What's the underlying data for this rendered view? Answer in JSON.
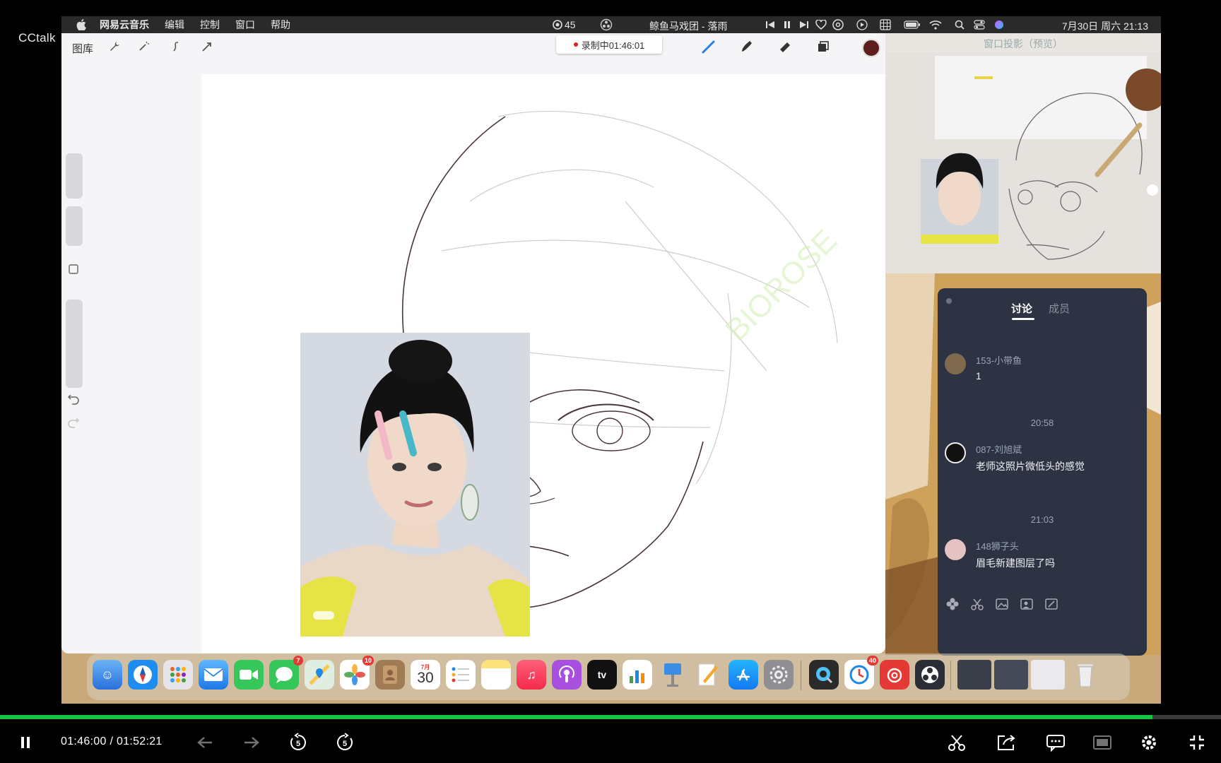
{
  "cctalk": {
    "logo": "CCtalk"
  },
  "menubar": {
    "app_name": "网易云音乐",
    "menus": [
      "编辑",
      "控制",
      "窗口",
      "帮助"
    ],
    "badge_count": "45",
    "song_title": "鲸鱼马戏团 - 落雨",
    "datetime": "7月30日 周六 21:13"
  },
  "procreate": {
    "gallery_label": "图库",
    "recording_label": "录制中01:46:01",
    "brush_color": "#5e1e1e"
  },
  "projection": {
    "title": "窗口投影（预览）"
  },
  "chat": {
    "tabs": [
      {
        "label": "讨论",
        "active": true
      },
      {
        "label": "成员",
        "active": false
      }
    ],
    "messages": [
      {
        "time": "",
        "user": "153-小带鱼",
        "text": "1"
      },
      {
        "time": "20:58",
        "user": "087-刘旭斌",
        "text": "老师这照片微低头的感觉"
      },
      {
        "time": "21:03",
        "user": "148狮子头",
        "text": "眉毛新建图层了吗"
      }
    ]
  },
  "dock": {
    "messages_badge": "7",
    "photos_badge": "10",
    "calendar_month": "7月",
    "calendar_day": "30",
    "qq_badge": "40"
  },
  "player": {
    "current_time": "01:46:00",
    "separator": "/",
    "total_time": "01:52:21",
    "progress": 0.9439,
    "accent": "#19c341"
  }
}
